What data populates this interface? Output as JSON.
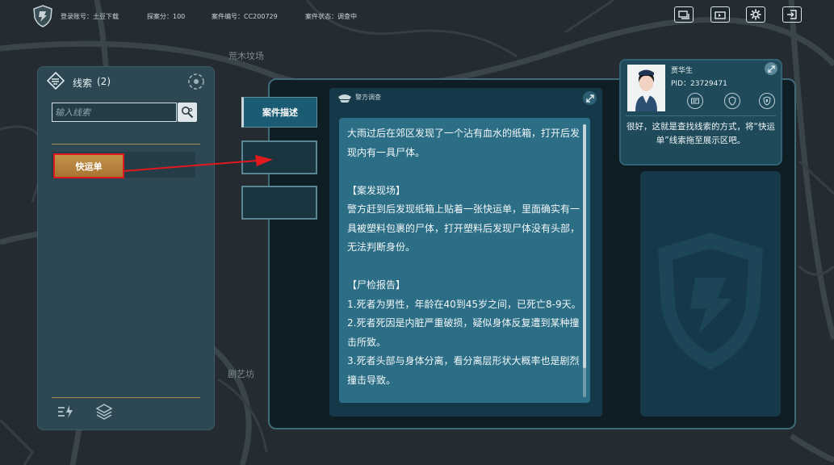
{
  "topbar": {
    "account": "登录账号：土豆下载",
    "score": "探案分：100",
    "case_no": "案件编号：CC200729",
    "status": "案件状态：调查中",
    "buttons": [
      "screen-icon",
      "exit-screen-icon",
      "settings-icon",
      "logout-icon"
    ]
  },
  "map": {
    "label_top": "荒木坟场",
    "label_bottom": "剧艺坊"
  },
  "clues": {
    "title": "线索",
    "count": "(2)",
    "search_placeholder": "输入线索",
    "items": [
      {
        "label": "快运单"
      }
    ],
    "highlight_color": "#e0191e"
  },
  "tabs": [
    {
      "label": "案件描述"
    },
    {
      "label": ""
    },
    {
      "label": ""
    }
  ],
  "document": {
    "header": "警方调查",
    "paragraphs": [
      "大雨过后在郊区发现了一个沾有血水的纸箱，打开后发现内有一具尸体。",
      "",
      "【案发现场】",
      "警方赶到后发现纸箱上贴着一张快运单，里面确实有一具被塑料包裹的尸体，打开塑料后发现尸体没有头部，无法判断身份。",
      "",
      "【尸检报告】",
      "1.死者为男性，年龄在40到45岁之间，已死亡8-9天。",
      "2.死者死因是内脏严重破损，疑似身体反复遭到某种撞击所致。",
      "3.死者头部与身体分离，看分离层形状大概率也是剧烈撞击导致。"
    ]
  },
  "character": {
    "name": "贾华生",
    "pid": "PID：23729471",
    "message": "很好，这就是查找线索的方式，将“快运单”线索拖至展示区吧。"
  },
  "colors": {
    "accent_gold": "#c29149",
    "panel_teal": "#2b6e86",
    "arrow_red": "#e0191e"
  }
}
